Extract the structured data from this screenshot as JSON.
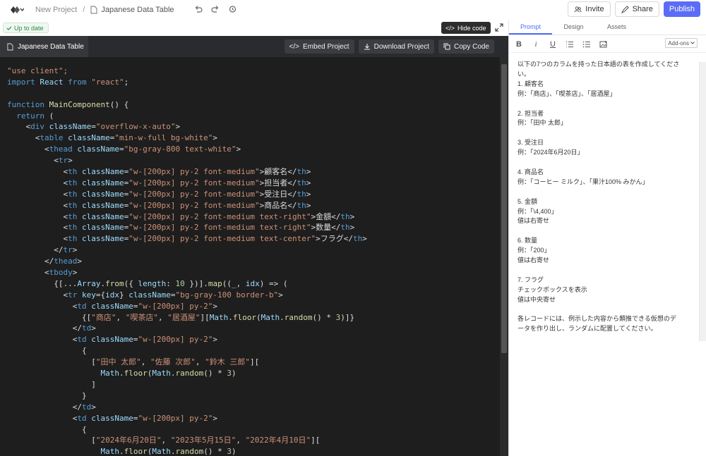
{
  "topbar": {
    "breadcrumb_project": "New Project",
    "breadcrumb_separator": "/",
    "breadcrumb_current": "Japanese Data Table",
    "invite_label": "Invite",
    "share_label": "Share",
    "publish_label": "Publish"
  },
  "status": {
    "up_to_date": "Up to date",
    "hide_code": "Hide code"
  },
  "code_header": {
    "file_name": "Japanese Data Table",
    "embed_label": "Embed Project",
    "download_label": "Download Project",
    "copy_label": "Copy Code"
  },
  "code_lines": [
    [
      {
        "t": "\"use client\";",
        "c": "str"
      }
    ],
    [
      {
        "t": "import ",
        "c": "kw"
      },
      {
        "t": "React ",
        "c": "attr"
      },
      {
        "t": "from ",
        "c": "kw"
      },
      {
        "t": "\"react\"",
        "c": "str"
      },
      {
        "t": ";",
        "c": ""
      }
    ],
    [
      {
        "t": "",
        "c": ""
      }
    ],
    [
      {
        "t": "function ",
        "c": "kw"
      },
      {
        "t": "MainComponent",
        "c": "fn"
      },
      {
        "t": "() {",
        "c": ""
      }
    ],
    [
      {
        "t": "  return ",
        "c": "kw"
      },
      {
        "t": "(",
        "c": ""
      }
    ],
    [
      {
        "t": "    <",
        "c": ""
      },
      {
        "t": "div ",
        "c": "tag"
      },
      {
        "t": "className",
        "c": "attr"
      },
      {
        "t": "=",
        "c": ""
      },
      {
        "t": "\"overflow-x-auto\"",
        "c": "str"
      },
      {
        "t": ">",
        "c": ""
      }
    ],
    [
      {
        "t": "      <",
        "c": ""
      },
      {
        "t": "table ",
        "c": "tag"
      },
      {
        "t": "className",
        "c": "attr"
      },
      {
        "t": "=",
        "c": ""
      },
      {
        "t": "\"min-w-full bg-white\"",
        "c": "str"
      },
      {
        "t": ">",
        "c": ""
      }
    ],
    [
      {
        "t": "        <",
        "c": ""
      },
      {
        "t": "thead ",
        "c": "tag"
      },
      {
        "t": "className",
        "c": "attr"
      },
      {
        "t": "=",
        "c": ""
      },
      {
        "t": "\"bg-gray-800 text-white\"",
        "c": "str"
      },
      {
        "t": ">",
        "c": ""
      }
    ],
    [
      {
        "t": "          <",
        "c": ""
      },
      {
        "t": "tr",
        "c": "tag"
      },
      {
        "t": ">",
        "c": ""
      }
    ],
    [
      {
        "t": "            <",
        "c": ""
      },
      {
        "t": "th ",
        "c": "tag"
      },
      {
        "t": "className",
        "c": "attr"
      },
      {
        "t": "=",
        "c": ""
      },
      {
        "t": "\"w-[200px] py-2 font-medium\"",
        "c": "str"
      },
      {
        "t": ">顧客名</",
        "c": ""
      },
      {
        "t": "th",
        "c": "tag"
      },
      {
        "t": ">",
        "c": ""
      }
    ],
    [
      {
        "t": "            <",
        "c": ""
      },
      {
        "t": "th ",
        "c": "tag"
      },
      {
        "t": "className",
        "c": "attr"
      },
      {
        "t": "=",
        "c": ""
      },
      {
        "t": "\"w-[200px] py-2 font-medium\"",
        "c": "str"
      },
      {
        "t": ">担当者</",
        "c": ""
      },
      {
        "t": "th",
        "c": "tag"
      },
      {
        "t": ">",
        "c": ""
      }
    ],
    [
      {
        "t": "            <",
        "c": ""
      },
      {
        "t": "th ",
        "c": "tag"
      },
      {
        "t": "className",
        "c": "attr"
      },
      {
        "t": "=",
        "c": ""
      },
      {
        "t": "\"w-[200px] py-2 font-medium\"",
        "c": "str"
      },
      {
        "t": ">受注日</",
        "c": ""
      },
      {
        "t": "th",
        "c": "tag"
      },
      {
        "t": ">",
        "c": ""
      }
    ],
    [
      {
        "t": "            <",
        "c": ""
      },
      {
        "t": "th ",
        "c": "tag"
      },
      {
        "t": "className",
        "c": "attr"
      },
      {
        "t": "=",
        "c": ""
      },
      {
        "t": "\"w-[200px] py-2 font-medium\"",
        "c": "str"
      },
      {
        "t": ">商品名</",
        "c": ""
      },
      {
        "t": "th",
        "c": "tag"
      },
      {
        "t": ">",
        "c": ""
      }
    ],
    [
      {
        "t": "            <",
        "c": ""
      },
      {
        "t": "th ",
        "c": "tag"
      },
      {
        "t": "className",
        "c": "attr"
      },
      {
        "t": "=",
        "c": ""
      },
      {
        "t": "\"w-[200px] py-2 font-medium text-right\"",
        "c": "str"
      },
      {
        "t": ">金額</",
        "c": ""
      },
      {
        "t": "th",
        "c": "tag"
      },
      {
        "t": ">",
        "c": ""
      }
    ],
    [
      {
        "t": "            <",
        "c": ""
      },
      {
        "t": "th ",
        "c": "tag"
      },
      {
        "t": "className",
        "c": "attr"
      },
      {
        "t": "=",
        "c": ""
      },
      {
        "t": "\"w-[200px] py-2 font-medium text-right\"",
        "c": "str"
      },
      {
        "t": ">数量</",
        "c": ""
      },
      {
        "t": "th",
        "c": "tag"
      },
      {
        "t": ">",
        "c": ""
      }
    ],
    [
      {
        "t": "            <",
        "c": ""
      },
      {
        "t": "th ",
        "c": "tag"
      },
      {
        "t": "className",
        "c": "attr"
      },
      {
        "t": "=",
        "c": ""
      },
      {
        "t": "\"w-[200px] py-2 font-medium text-center\"",
        "c": "str"
      },
      {
        "t": ">フラグ</",
        "c": ""
      },
      {
        "t": "th",
        "c": "tag"
      },
      {
        "t": ">",
        "c": ""
      }
    ],
    [
      {
        "t": "          </",
        "c": ""
      },
      {
        "t": "tr",
        "c": "tag"
      },
      {
        "t": ">",
        "c": ""
      }
    ],
    [
      {
        "t": "        </",
        "c": ""
      },
      {
        "t": "thead",
        "c": "tag"
      },
      {
        "t": ">",
        "c": ""
      }
    ],
    [
      {
        "t": "        <",
        "c": ""
      },
      {
        "t": "tbody",
        "c": "tag"
      },
      {
        "t": ">",
        "c": ""
      }
    ],
    [
      {
        "t": "          {[...",
        "c": ""
      },
      {
        "t": "Array",
        "c": "attr"
      },
      {
        "t": ".",
        "c": ""
      },
      {
        "t": "from",
        "c": "fn"
      },
      {
        "t": "({ ",
        "c": ""
      },
      {
        "t": "length",
        "c": "attr"
      },
      {
        "t": ": ",
        "c": ""
      },
      {
        "t": "10",
        "c": "num"
      },
      {
        "t": " })].",
        "c": ""
      },
      {
        "t": "map",
        "c": "fn"
      },
      {
        "t": "((",
        "c": ""
      },
      {
        "t": "_",
        "c": "attr"
      },
      {
        "t": ", ",
        "c": ""
      },
      {
        "t": "idx",
        "c": "attr"
      },
      {
        "t": ") => (",
        "c": ""
      }
    ],
    [
      {
        "t": "            <",
        "c": ""
      },
      {
        "t": "tr ",
        "c": "tag"
      },
      {
        "t": "key",
        "c": "attr"
      },
      {
        "t": "={",
        "c": ""
      },
      {
        "t": "idx",
        "c": "attr"
      },
      {
        "t": "} ",
        "c": ""
      },
      {
        "t": "className",
        "c": "attr"
      },
      {
        "t": "=",
        "c": ""
      },
      {
        "t": "\"bg-gray-100 border-b\"",
        "c": "str"
      },
      {
        "t": ">",
        "c": ""
      }
    ],
    [
      {
        "t": "              <",
        "c": ""
      },
      {
        "t": "td ",
        "c": "tag"
      },
      {
        "t": "className",
        "c": "attr"
      },
      {
        "t": "=",
        "c": ""
      },
      {
        "t": "\"w-[200px] py-2\"",
        "c": "str"
      },
      {
        "t": ">",
        "c": ""
      }
    ],
    [
      {
        "t": "                {[",
        "c": ""
      },
      {
        "t": "\"商店\"",
        "c": "str"
      },
      {
        "t": ", ",
        "c": ""
      },
      {
        "t": "\"喫茶店\"",
        "c": "str"
      },
      {
        "t": ", ",
        "c": ""
      },
      {
        "t": "\"居酒屋\"",
        "c": "str"
      },
      {
        "t": "][",
        "c": ""
      },
      {
        "t": "Math",
        "c": "attr"
      },
      {
        "t": ".",
        "c": ""
      },
      {
        "t": "floor",
        "c": "fn"
      },
      {
        "t": "(",
        "c": ""
      },
      {
        "t": "Math",
        "c": "attr"
      },
      {
        "t": ".",
        "c": ""
      },
      {
        "t": "random",
        "c": "fn"
      },
      {
        "t": "() * ",
        "c": ""
      },
      {
        "t": "3",
        "c": "num"
      },
      {
        "t": ")]}",
        "c": ""
      }
    ],
    [
      {
        "t": "              </",
        "c": ""
      },
      {
        "t": "td",
        "c": "tag"
      },
      {
        "t": ">",
        "c": ""
      }
    ],
    [
      {
        "t": "              <",
        "c": ""
      },
      {
        "t": "td ",
        "c": "tag"
      },
      {
        "t": "className",
        "c": "attr"
      },
      {
        "t": "=",
        "c": ""
      },
      {
        "t": "\"w-[200px] py-2\"",
        "c": "str"
      },
      {
        "t": ">",
        "c": ""
      }
    ],
    [
      {
        "t": "                {",
        "c": ""
      }
    ],
    [
      {
        "t": "                  [",
        "c": ""
      },
      {
        "t": "\"田中 太郎\"",
        "c": "str"
      },
      {
        "t": ", ",
        "c": ""
      },
      {
        "t": "\"佐藤 次郎\"",
        "c": "str"
      },
      {
        "t": ", ",
        "c": ""
      },
      {
        "t": "\"鈴木 三郎\"",
        "c": "str"
      },
      {
        "t": "][",
        "c": ""
      }
    ],
    [
      {
        "t": "                    ",
        "c": ""
      },
      {
        "t": "Math",
        "c": "attr"
      },
      {
        "t": ".",
        "c": ""
      },
      {
        "t": "floor",
        "c": "fn"
      },
      {
        "t": "(",
        "c": ""
      },
      {
        "t": "Math",
        "c": "attr"
      },
      {
        "t": ".",
        "c": ""
      },
      {
        "t": "random",
        "c": "fn"
      },
      {
        "t": "() * ",
        "c": ""
      },
      {
        "t": "3",
        "c": "num"
      },
      {
        "t": ")",
        "c": ""
      }
    ],
    [
      {
        "t": "                  ]",
        "c": ""
      }
    ],
    [
      {
        "t": "                }",
        "c": ""
      }
    ],
    [
      {
        "t": "              </",
        "c": ""
      },
      {
        "t": "td",
        "c": "tag"
      },
      {
        "t": ">",
        "c": ""
      }
    ],
    [
      {
        "t": "              <",
        "c": ""
      },
      {
        "t": "td ",
        "c": "tag"
      },
      {
        "t": "className",
        "c": "attr"
      },
      {
        "t": "=",
        "c": ""
      },
      {
        "t": "\"w-[200px] py-2\"",
        "c": "str"
      },
      {
        "t": ">",
        "c": ""
      }
    ],
    [
      {
        "t": "                {",
        "c": ""
      }
    ],
    [
      {
        "t": "                  [",
        "c": ""
      },
      {
        "t": "\"2024年6月20日\"",
        "c": "str"
      },
      {
        "t": ", ",
        "c": ""
      },
      {
        "t": "\"2023年5月15日\"",
        "c": "str"
      },
      {
        "t": ", ",
        "c": ""
      },
      {
        "t": "\"2022年4月10日\"",
        "c": "str"
      },
      {
        "t": "][",
        "c": ""
      }
    ],
    [
      {
        "t": "                    ",
        "c": ""
      },
      {
        "t": "Math",
        "c": "attr"
      },
      {
        "t": ".",
        "c": ""
      },
      {
        "t": "floor",
        "c": "fn"
      },
      {
        "t": "(",
        "c": ""
      },
      {
        "t": "Math",
        "c": "attr"
      },
      {
        "t": ".",
        "c": ""
      },
      {
        "t": "random",
        "c": "fn"
      },
      {
        "t": "() * ",
        "c": ""
      },
      {
        "t": "3",
        "c": "num"
      },
      {
        "t": ")",
        "c": ""
      }
    ]
  ],
  "right_panel": {
    "tabs": [
      "Prompt",
      "Design",
      "Assets"
    ],
    "addons_label": "Add-ons",
    "prompt_lines": [
      "以下の7つのカラムを持った日本語の表を作成してくださ",
      "い。",
      "1. 顧客名",
      "例：「商店」、「喫茶店」、「居酒屋」",
      "",
      "2. 担当者",
      "例：「田中 太郎」",
      "",
      "3. 受注日",
      "例：「2024年6月20日」",
      "",
      "4. 商品名",
      "例：「コーヒー ミルク」、「果汁100% みかん」",
      "",
      "5. 金額",
      "例：「\\4,400」",
      "値は右寄せ",
      "",
      "6. 数量",
      "例：「200」",
      "値は右寄せ",
      "",
      "7. フラグ",
      "チェックボックスを表示",
      "値は中央寄せ",
      "",
      "各レコードには、例示した内容から類推できる仮想のデ",
      "ータを作り出し、ランダムに配置してください。"
    ]
  }
}
